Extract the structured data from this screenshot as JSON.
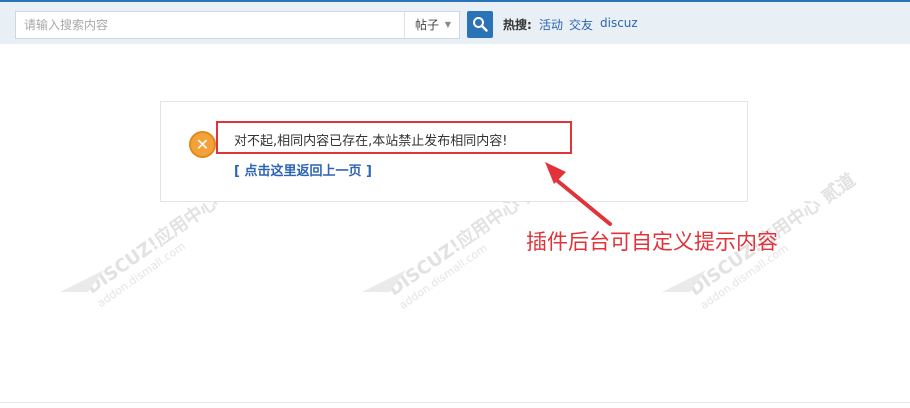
{
  "search": {
    "placeholder": "请输入搜索内容",
    "type_selected": "帖子",
    "hot_label": "热搜:",
    "hot_links": [
      "活动",
      "交友",
      "discuz"
    ]
  },
  "notice": {
    "message": "对不起,相同内容已存在,本站禁止发布相同内容!",
    "back_link": "[ 点击这里返回上一页 ]"
  },
  "annotation": {
    "text": "插件后台可自定义提示内容",
    "color": "#e0333a"
  },
  "watermark": {
    "line1": "DISCUZ!应用中心",
    "line2": "addon.dismall.com",
    "brand": "贰道"
  },
  "colors": {
    "accent": "#2b73b7",
    "link": "#2d64b3",
    "alert": "#f3a23a"
  }
}
